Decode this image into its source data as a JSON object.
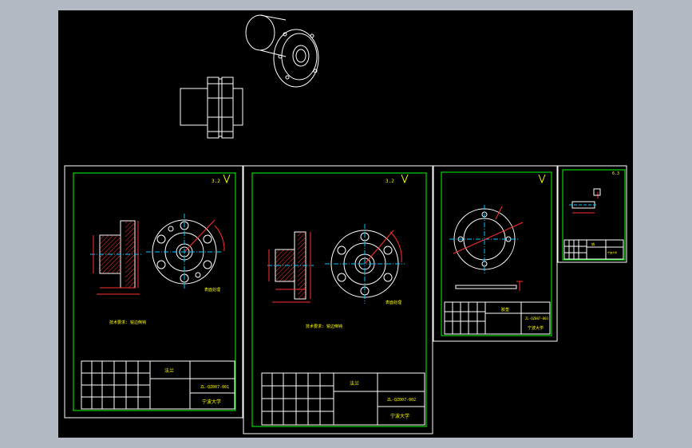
{
  "sheets": [
    {
      "id": "sheet-1",
      "title_block_name": "法兰",
      "drawing_no": "ZL-QZ007-001",
      "company": "宁波大学",
      "notes": "技术要求: 锐边倒钝",
      "scale_label": "1:2",
      "roughness": "3.2"
    },
    {
      "id": "sheet-2",
      "title_block_name": "法兰",
      "drawing_no": "ZL-QZ007-002",
      "company": "宁波大学",
      "notes": "技术要求: 锐边倒钝",
      "scale_label": "1:2",
      "roughness": "3.2"
    },
    {
      "id": "sheet-3",
      "title_block_name": "胶垫",
      "drawing_no": "ZL-QZ007-003",
      "company": "宁波大学",
      "scale_label": "1:1"
    },
    {
      "id": "sheet-4",
      "title_block_name": "销",
      "drawing_no": "ZL-QZ007-004",
      "company": "宁波大学",
      "roughness": "6.3"
    }
  ],
  "colors": {
    "background": "#000000",
    "outer_frame": "#ffffff",
    "frame": "#00ff00",
    "dimension": "#ff3030",
    "centerline": "#00c8ff",
    "annotation": "#ffff00",
    "geometry": "#ffffff"
  }
}
